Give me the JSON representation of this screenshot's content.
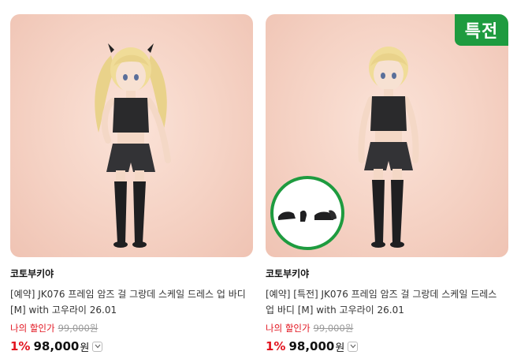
{
  "products": [
    {
      "brand": "코토부키야",
      "title": "[예약] JK076 프레임 암즈 걸 그랑데 스케일 드레스 업 바디 [M] with 고우라이 26.01",
      "discount_label": "나의 할인가",
      "original_price": "99,000원",
      "discount_rate": "1%",
      "price": "98,000",
      "currency": "원",
      "badge": "",
      "image_icon": "figure-twintail-image"
    },
    {
      "brand": "코토부키야",
      "title": "[예약] [특전] JK076 프레임 암즈 걸 그랑데 스케일 드레스 업 바디 [M] with 고우라이 26.01",
      "discount_label": "나의 할인가",
      "original_price": "99,000원",
      "discount_rate": "1%",
      "price": "98,000",
      "currency": "원",
      "badge": "특전",
      "image_icon": "figure-shorthair-image"
    }
  ],
  "colors": {
    "accent_red": "#e2141f",
    "badge_green": "#1e9b3f",
    "image_bg": "#f5d2c4"
  }
}
